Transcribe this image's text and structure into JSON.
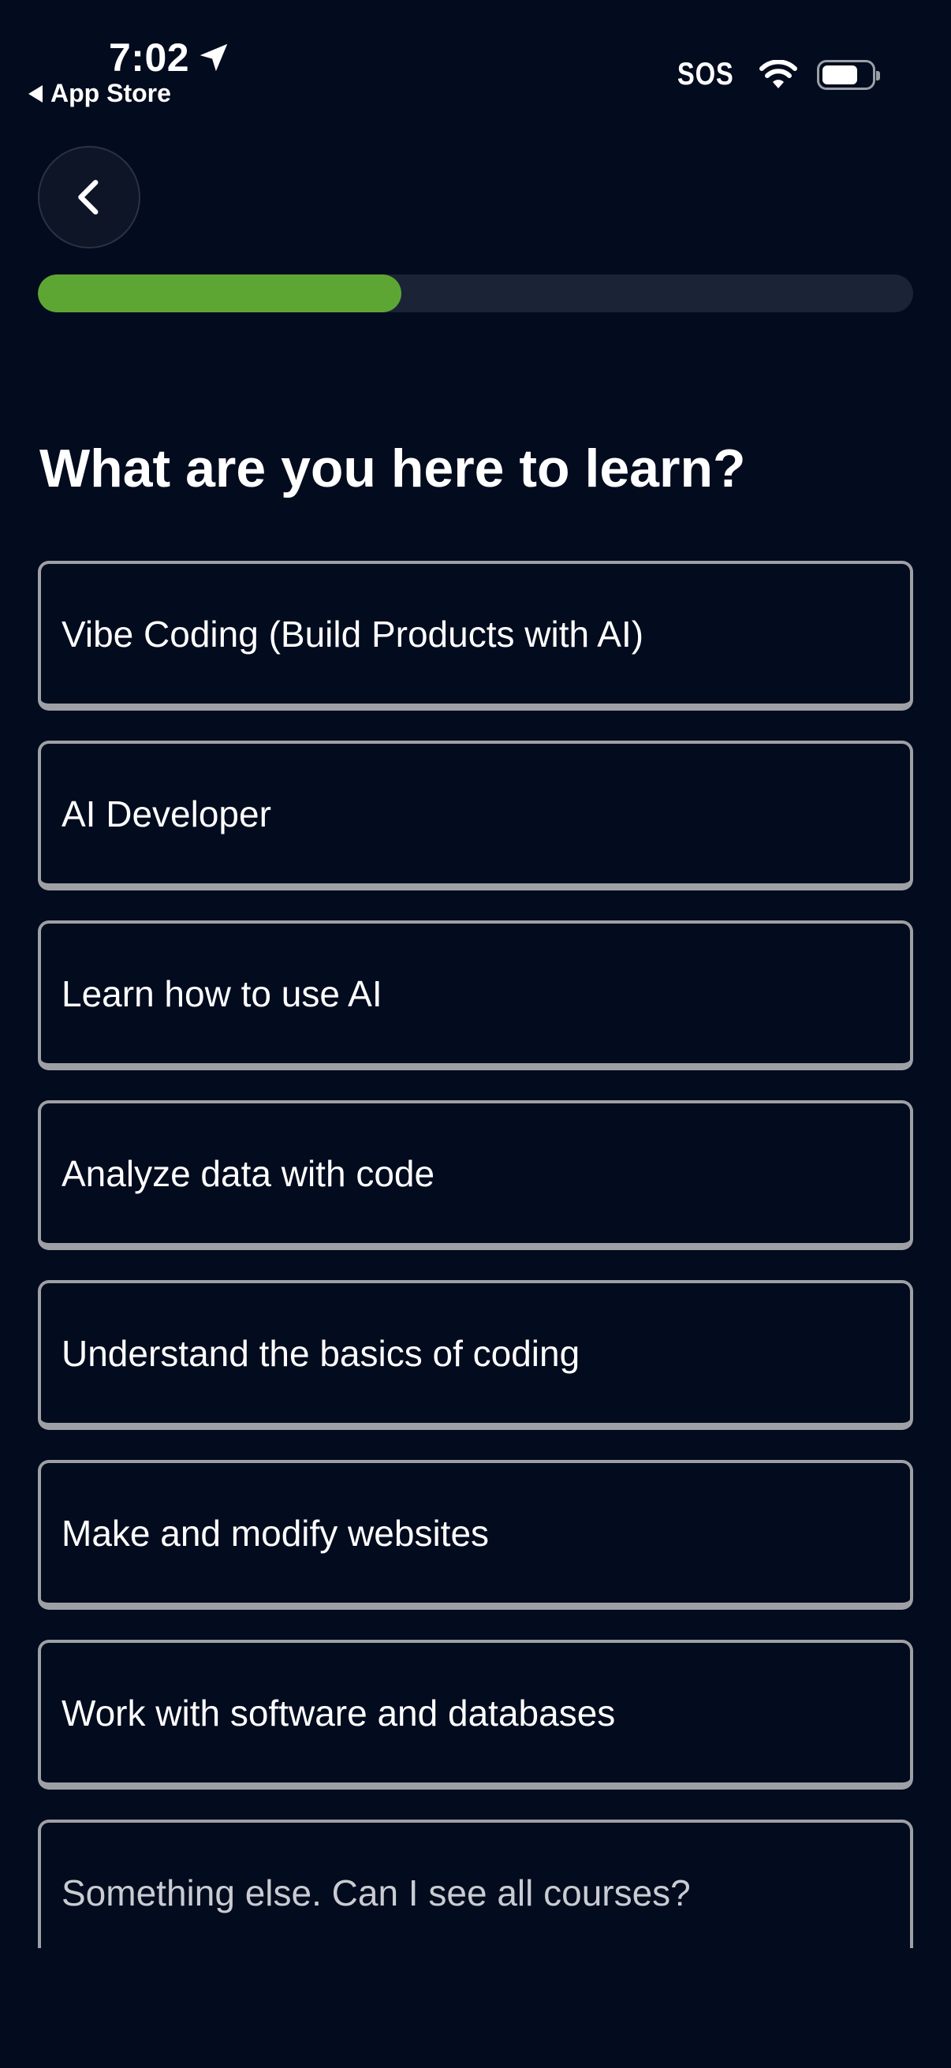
{
  "status_bar": {
    "time": "7:02",
    "back_app": "App Store",
    "sos": "SOS"
  },
  "header": {
    "back_icon": "chevron-left-icon",
    "progress": 0.415
  },
  "question": "What are you here to learn?",
  "options": [
    "Vibe Coding (Build Products with AI)",
    "AI Developer",
    "Learn how to use AI",
    "Analyze data with code",
    "Understand the basics of coding",
    "Make and modify websites",
    "Work with software and databases",
    "Something else. Can I see all courses?"
  ],
  "colors": {
    "background": "#030b1e",
    "progress_fill": "#5ea634",
    "progress_track": "#1b2436",
    "option_border": "#9ea0a5"
  }
}
